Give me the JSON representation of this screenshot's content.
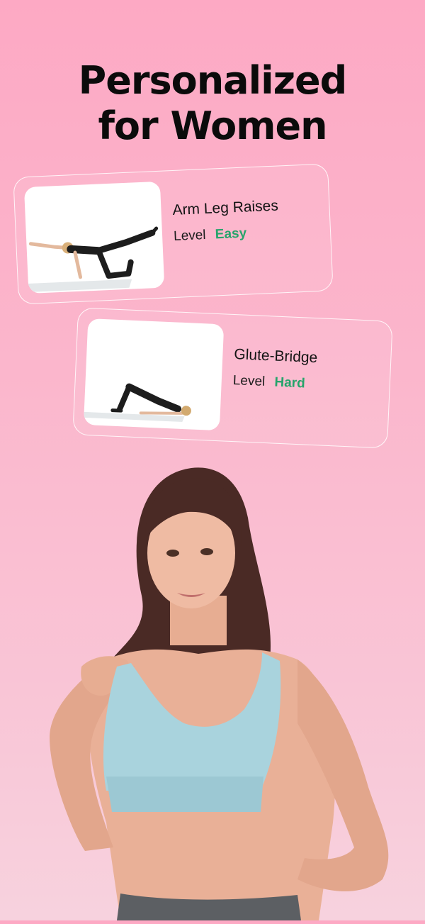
{
  "title": {
    "line1": "Personalized",
    "line2": "for Women"
  },
  "exercises": [
    {
      "name": "Arm Leg Raises",
      "level_label": "Level",
      "level_value": "Easy"
    },
    {
      "name": "Glute-Bridge",
      "level_label": "Level",
      "level_value": "Hard"
    }
  ],
  "colors": {
    "background_top": "#fda9c4",
    "background_bottom": "#f7d2de",
    "level_green": "#26a46b",
    "sports_bra": "#a9d3dd"
  }
}
